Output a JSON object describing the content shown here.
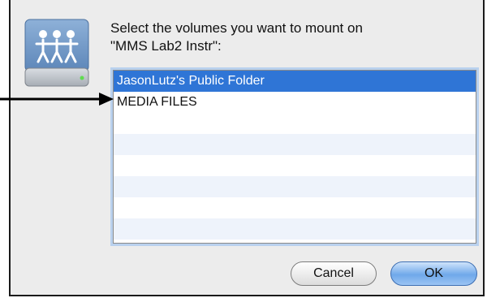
{
  "dialog": {
    "prompt_line1": "Select the volumes you want to mount on",
    "prompt_line2": "\"MMS Lab2 Instr\":",
    "icon": "shared-volume-icon"
  },
  "volumes": [
    {
      "label": "JasonLutz's Public Folder",
      "selected": true
    },
    {
      "label": "MEDIA FILES",
      "selected": false
    }
  ],
  "buttons": {
    "cancel_label": "Cancel",
    "ok_label": "OK"
  },
  "colors": {
    "selection": "#2f75d6",
    "focus_ring": "#b9d1ee"
  }
}
